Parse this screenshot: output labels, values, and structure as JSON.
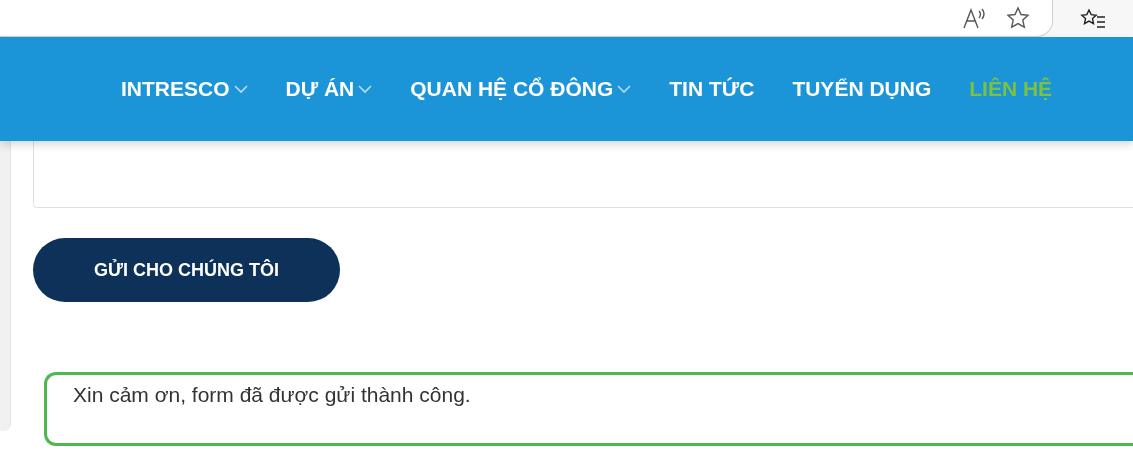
{
  "nav": {
    "items": [
      {
        "label": "INTRESCO",
        "has_dropdown": true,
        "selected": false
      },
      {
        "label": "DỰ ÁN",
        "has_dropdown": true,
        "selected": false
      },
      {
        "label": "QUAN HỆ CỔ ĐÔNG",
        "has_dropdown": true,
        "selected": false
      },
      {
        "label": "TIN TỨC",
        "has_dropdown": false,
        "selected": false
      },
      {
        "label": "TUYỂN DỤNG",
        "has_dropdown": false,
        "selected": false
      },
      {
        "label": "LIÊN HỆ",
        "has_dropdown": false,
        "selected": true
      }
    ]
  },
  "form": {
    "submit_button": "GỬI CHO CHÚNG TÔI",
    "success_message": "Xin cảm ơn, form đã được gửi thành công."
  }
}
